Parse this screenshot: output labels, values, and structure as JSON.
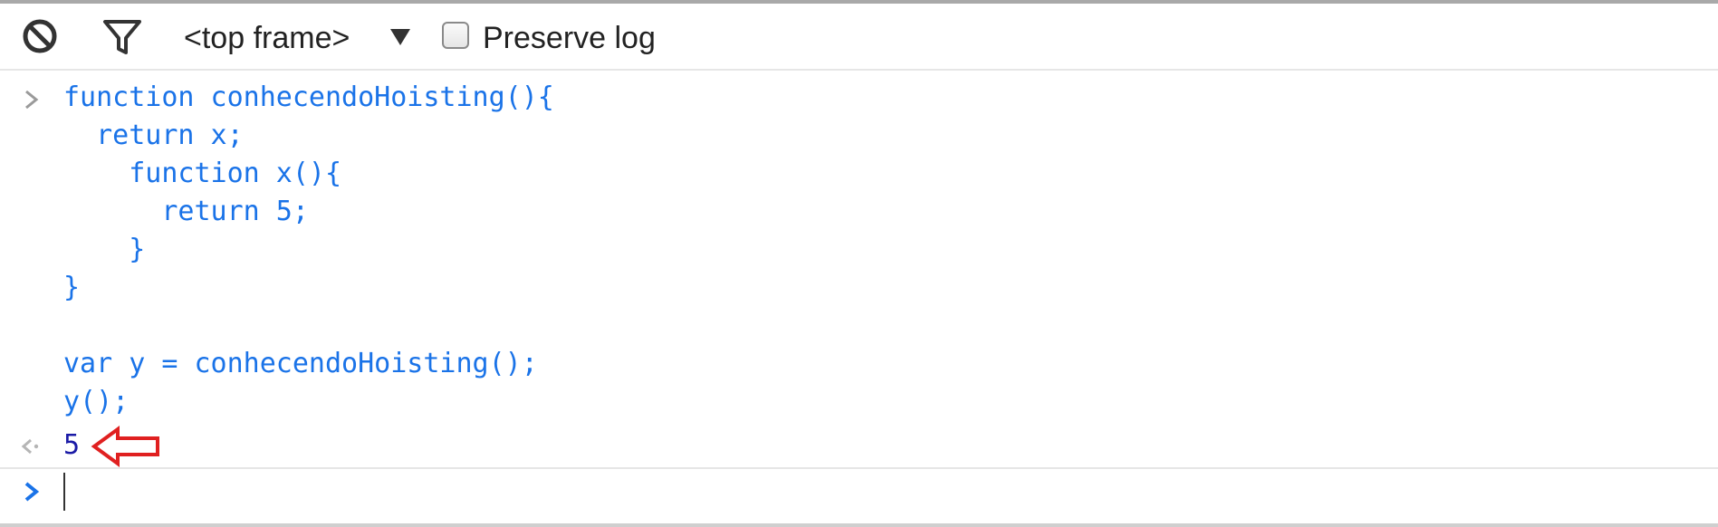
{
  "toolbar": {
    "clear_icon": "clear-console-icon",
    "filter_icon": "filter-icon",
    "context": "<top frame>",
    "dropdown_icon": "triangle-down-icon",
    "preserve_log_label": "Preserve log",
    "preserve_log_checked": false
  },
  "console": {
    "input_code": "function conhecendoHoisting(){\n  return x;\n    function x(){\n      return 5;\n    }\n}\n\nvar y = conhecendoHoisting();\ny();",
    "result": "5",
    "input_prompt_icon": "chevron-right-icon",
    "result_prompt_icon": "result-arrow-icon",
    "active_prompt_icon": "chevron-right-icon",
    "annotation_icon": "red-left-arrow-icon"
  },
  "colors": {
    "code": "#1a73e8",
    "result": "#1a1aa6",
    "annotation": "#e02020",
    "prompt_gray": "#9a9a9a",
    "prompt_blue": "#1a73e8"
  }
}
